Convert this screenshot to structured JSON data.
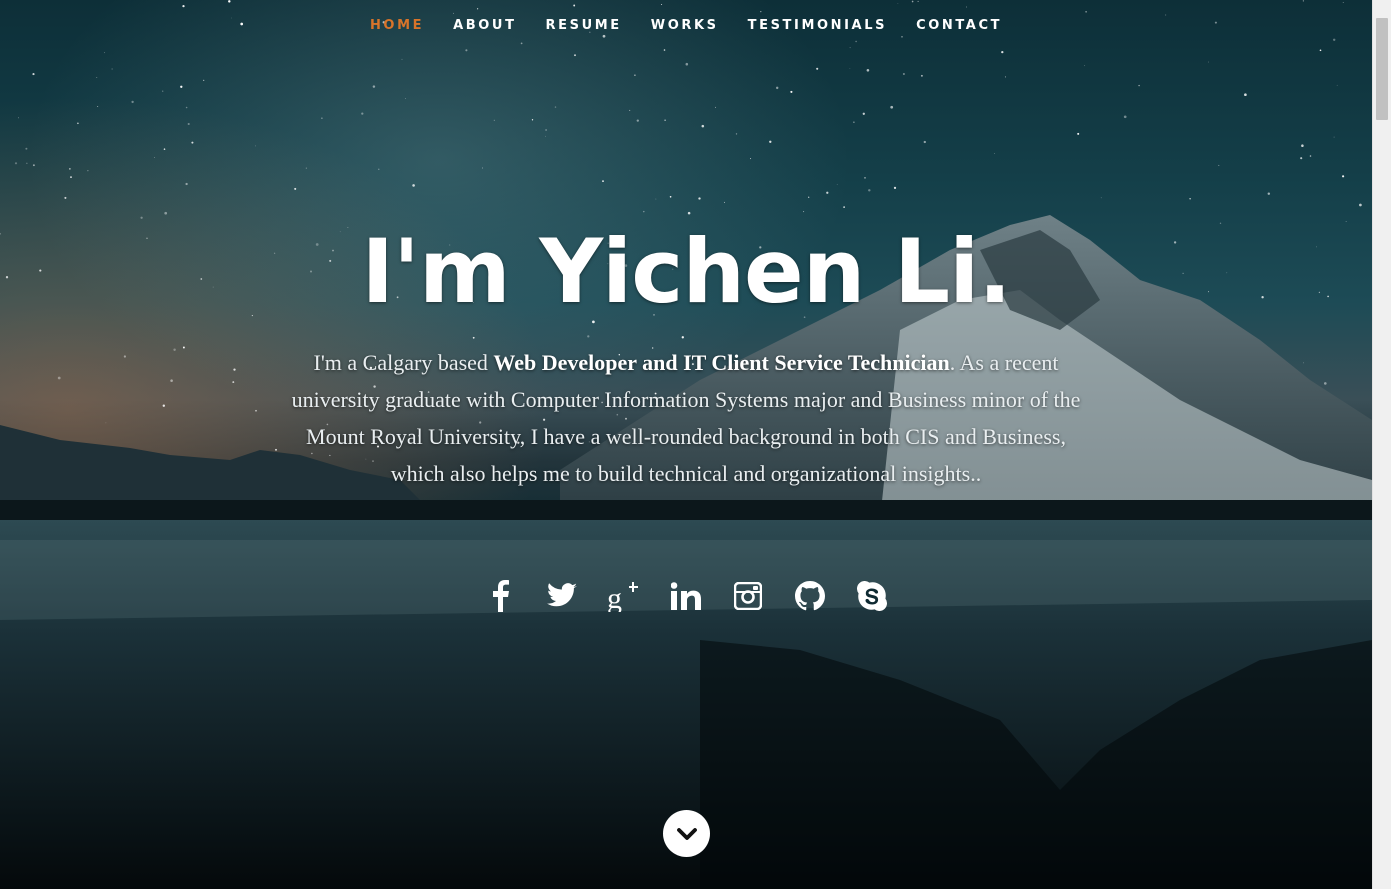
{
  "nav": {
    "items": [
      {
        "label": "HOME",
        "active": true
      },
      {
        "label": "ABOUT",
        "active": false
      },
      {
        "label": "RESUME",
        "active": false
      },
      {
        "label": "WORKS",
        "active": false
      },
      {
        "label": "TESTIMONIALS",
        "active": false
      },
      {
        "label": "CONTACT",
        "active": false
      }
    ],
    "active_color": "#d8742a"
  },
  "hero": {
    "title": "I'm Yichen Li.",
    "intro_before": "I'm a Calgary based ",
    "intro_bold": "Web Developer and IT Client Service Technician",
    "intro_after": ". As a recent university graduate with Computer Information Systems major and Business minor of the Mount Royal University, I have a well-rounded background in both CIS and Business, which also helps me to build technical and organizational insights.."
  },
  "social": {
    "icons": [
      "facebook-icon",
      "twitter-icon",
      "google-plus-icon",
      "linkedin-icon",
      "instagram-icon",
      "github-icon",
      "skype-icon"
    ]
  },
  "scroll_down": {
    "icon": "chevron-down-icon"
  }
}
